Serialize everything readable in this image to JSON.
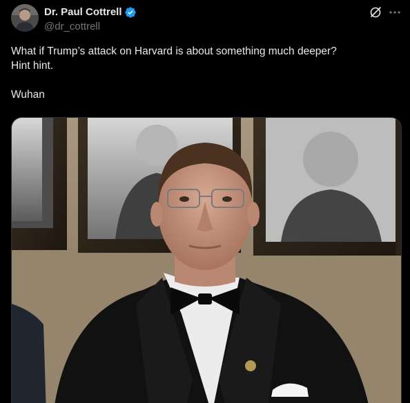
{
  "author": {
    "display_name": "Dr. Paul Cottrell",
    "handle": "@dr_cottrell",
    "verified": true
  },
  "tweet": {
    "lines": [
      "What if Trump’s attack on Harvard is about something much deeper?",
      "Hint hint.",
      "Wuhan"
    ]
  },
  "icons": {
    "verified": "verified-badge-icon",
    "grok": "grok-icon",
    "more": "more-icon"
  },
  "colors": {
    "background": "#000000",
    "text_primary": "#e7e9ea",
    "text_secondary": "#71767b",
    "verified_blue": "#1d9bf0"
  }
}
